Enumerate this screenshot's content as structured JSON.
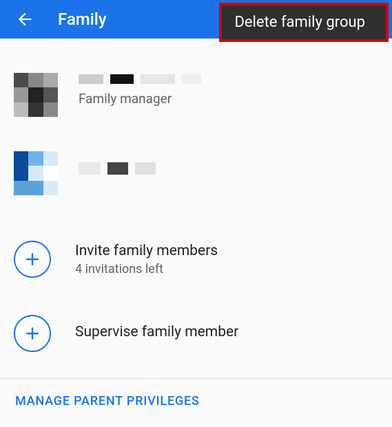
{
  "header": {
    "title": "Family"
  },
  "menu": {
    "delete_label": "Delete family group"
  },
  "members": [
    {
      "role": "Family manager"
    },
    {
      "role": ""
    }
  ],
  "actions": {
    "invite": {
      "title": "Invite family members",
      "subtitle": "4 invitations left"
    },
    "supervise": {
      "title": "Supervise family member"
    }
  },
  "manage_link": "MANAGE PARENT PRIVILEGES"
}
